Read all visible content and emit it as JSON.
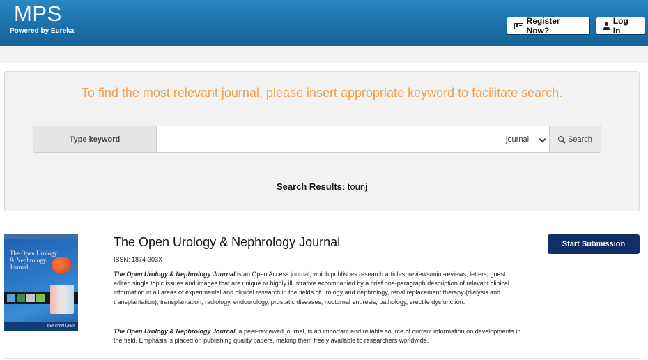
{
  "header": {
    "brand_title": "MPS",
    "brand_subtitle": "Powered by Eureka",
    "register_label": "Register Now?",
    "login_label": "Log In"
  },
  "search": {
    "prompt": "To find the most relevant journal, please insert appropriate keyword to facilitate search.",
    "keyword_label": "Type keyword",
    "keyword_value": "",
    "category_selected": "journal",
    "search_button": "Search",
    "results_label": "Search Results:",
    "results_query": "tounj"
  },
  "journal": {
    "title": "The Open Urology & Nephrology Journal",
    "issn": "ISSN: 1874-303X",
    "cover_title": "The Open Urology & Nephrology Journal",
    "cover_publisher": "BENTHAM OPEN",
    "name_emphasis": "The Open Urology & Nephrology Journal",
    "description_1": " is an Open Access journal, which publishes research articles, reviews/mini-reviews, letters, guest edited single topic issues and images that are unique or highly illustrative accompanied by a brief one-paragraph description of relevant clinical information in all areas of experimental and clinical research in the fields of urology and nephrology, renal replacement therapy (dialysis and transplantation), transplantation, radiology, endourology, prostatic diseases, nocturnal enuresis, pathology, erectile dysfunction.",
    "description_2": ", a peer-reviewed journal, is an important and reliable source of current information on developments in the field. Emphasis is placed on publishing quality papers, making them freely available to researchers worldwide.",
    "submit_label": "Start Submission"
  }
}
